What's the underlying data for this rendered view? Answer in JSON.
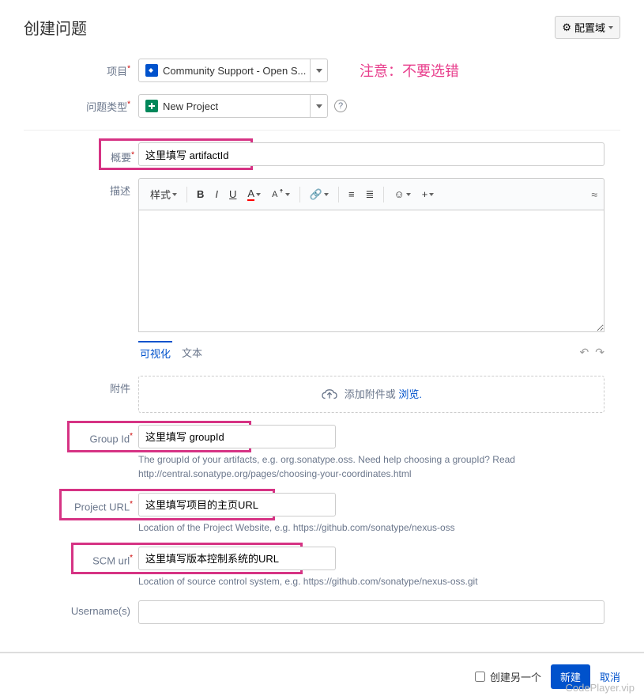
{
  "dialog": {
    "title": "创建问题",
    "configBtn": "配置域"
  },
  "annotation": "注意：不要选错",
  "fields": {
    "project": {
      "label": "项目",
      "value": "Community Support - Open S..."
    },
    "issueType": {
      "label": "问题类型",
      "value": "New Project"
    },
    "summary": {
      "label": "概要",
      "value": "这里填写 artifactId"
    },
    "description": {
      "label": "描述"
    },
    "attachment": {
      "label": "附件",
      "text": "添加附件或 ",
      "link": "浏览."
    },
    "groupId": {
      "label": "Group Id",
      "value": "这里填写 groupId",
      "help": "The groupId of your artifacts, e.g. org.sonatype.oss. Need help choosing a groupId? Read http://central.sonatype.org/pages/choosing-your-coordinates.html"
    },
    "projectUrl": {
      "label": "Project URL",
      "value": "这里填写项目的主页URL",
      "help": "Location of the Project Website, e.g. https://github.com/sonatype/nexus-oss"
    },
    "scmUrl": {
      "label": "SCM url",
      "value": "这里填写版本控制系统的URL",
      "help": "Location of source control system, e.g. https://github.com/sonatype/nexus-oss.git"
    },
    "usernames": {
      "label": "Username(s)"
    }
  },
  "editor": {
    "styleBtn": "样式",
    "tabs": {
      "visual": "可视化",
      "text": "文本"
    }
  },
  "footer": {
    "createAnother": "创建另一个",
    "create": "新建",
    "cancel": "取消"
  },
  "watermark": "CodePlayer.vip"
}
